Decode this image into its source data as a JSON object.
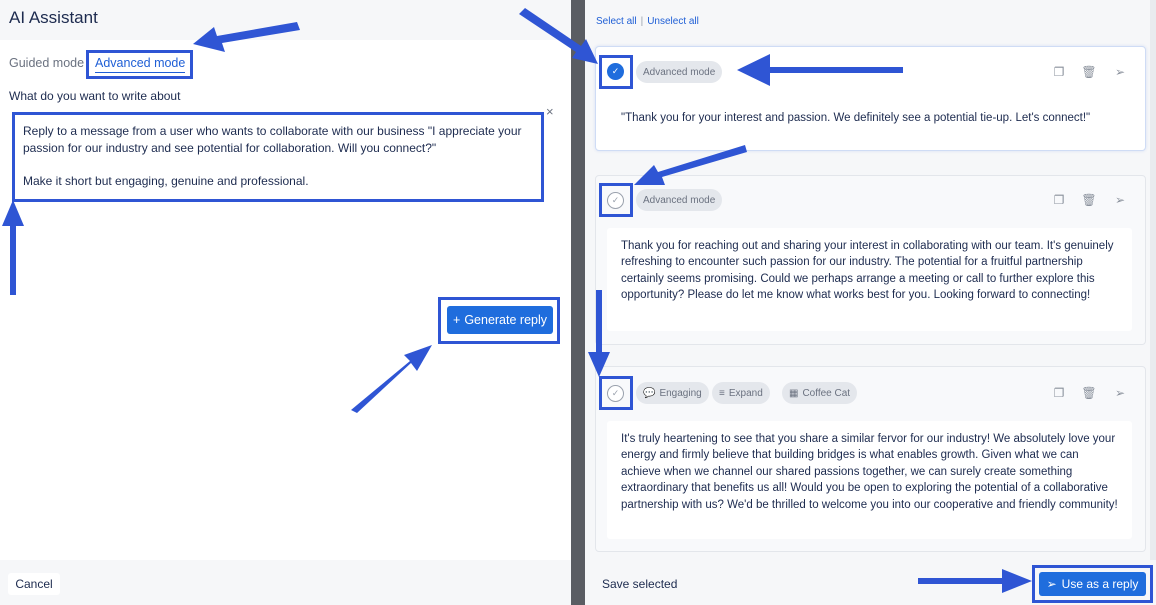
{
  "left": {
    "title": "AI Assistant",
    "tabs": [
      {
        "label": "Guided mode",
        "active": false
      },
      {
        "label": "Advanced mode",
        "active": true
      }
    ],
    "prompt_label": "What do you want to write about",
    "close_glyph": "×",
    "prompt_text": "Reply to a message from a user who wants to collaborate with our business \"I appreciate your passion for our industry and see potential for collaboration. Will you connect?\"\n\nMake it short but engaging, genuine and professional.",
    "generate_label": "Generate reply",
    "generate_icon": "sparkle-plus-icon",
    "cancel_label": "Cancel"
  },
  "right": {
    "select_all": "Select all",
    "unselect_all": "Unselect all",
    "results": [
      {
        "selected": true,
        "chips": [
          {
            "label": "Advanced mode",
            "icon": ""
          }
        ],
        "text": "\"Thank you for your interest and passion. We definitely see a potential tie-up. Let's connect!\""
      },
      {
        "selected": false,
        "chips": [
          {
            "label": "Advanced mode",
            "icon": ""
          }
        ],
        "text": "Thank you for reaching out and sharing your interest in collaborating with our team. It's genuinely refreshing to encounter such passion for our industry. The potential for a fruitful partnership certainly seems promising. Could we perhaps arrange a meeting or call to further explore this opportunity? Please do let me know what works best for you. Looking forward to connecting!"
      },
      {
        "selected": false,
        "chips": [
          {
            "label": "Engaging",
            "icon": "speech-bubble-icon"
          },
          {
            "label": "Expand",
            "icon": "lines-icon"
          },
          {
            "label": "Coffee Cat",
            "icon": "building-icon"
          }
        ],
        "text": "It's truly heartening to see that you share a similar fervor for our industry! We absolutely love your energy and firmly believe that building bridges is what enables growth. Given what we can achieve when we channel our shared passions together, we can surely create something extraordinary that benefits us all! Would you be open to exploring the potential of a collaborative partnership with us? We'd be thrilled to welcome you into our cooperative and friendly community!"
      }
    ],
    "save_selected": "Save selected",
    "use_as_reply": "Use as a reply"
  },
  "colors": {
    "accent": "#1f6ddd",
    "annotation": "#2f55d4",
    "text": "#1d2b4f"
  }
}
